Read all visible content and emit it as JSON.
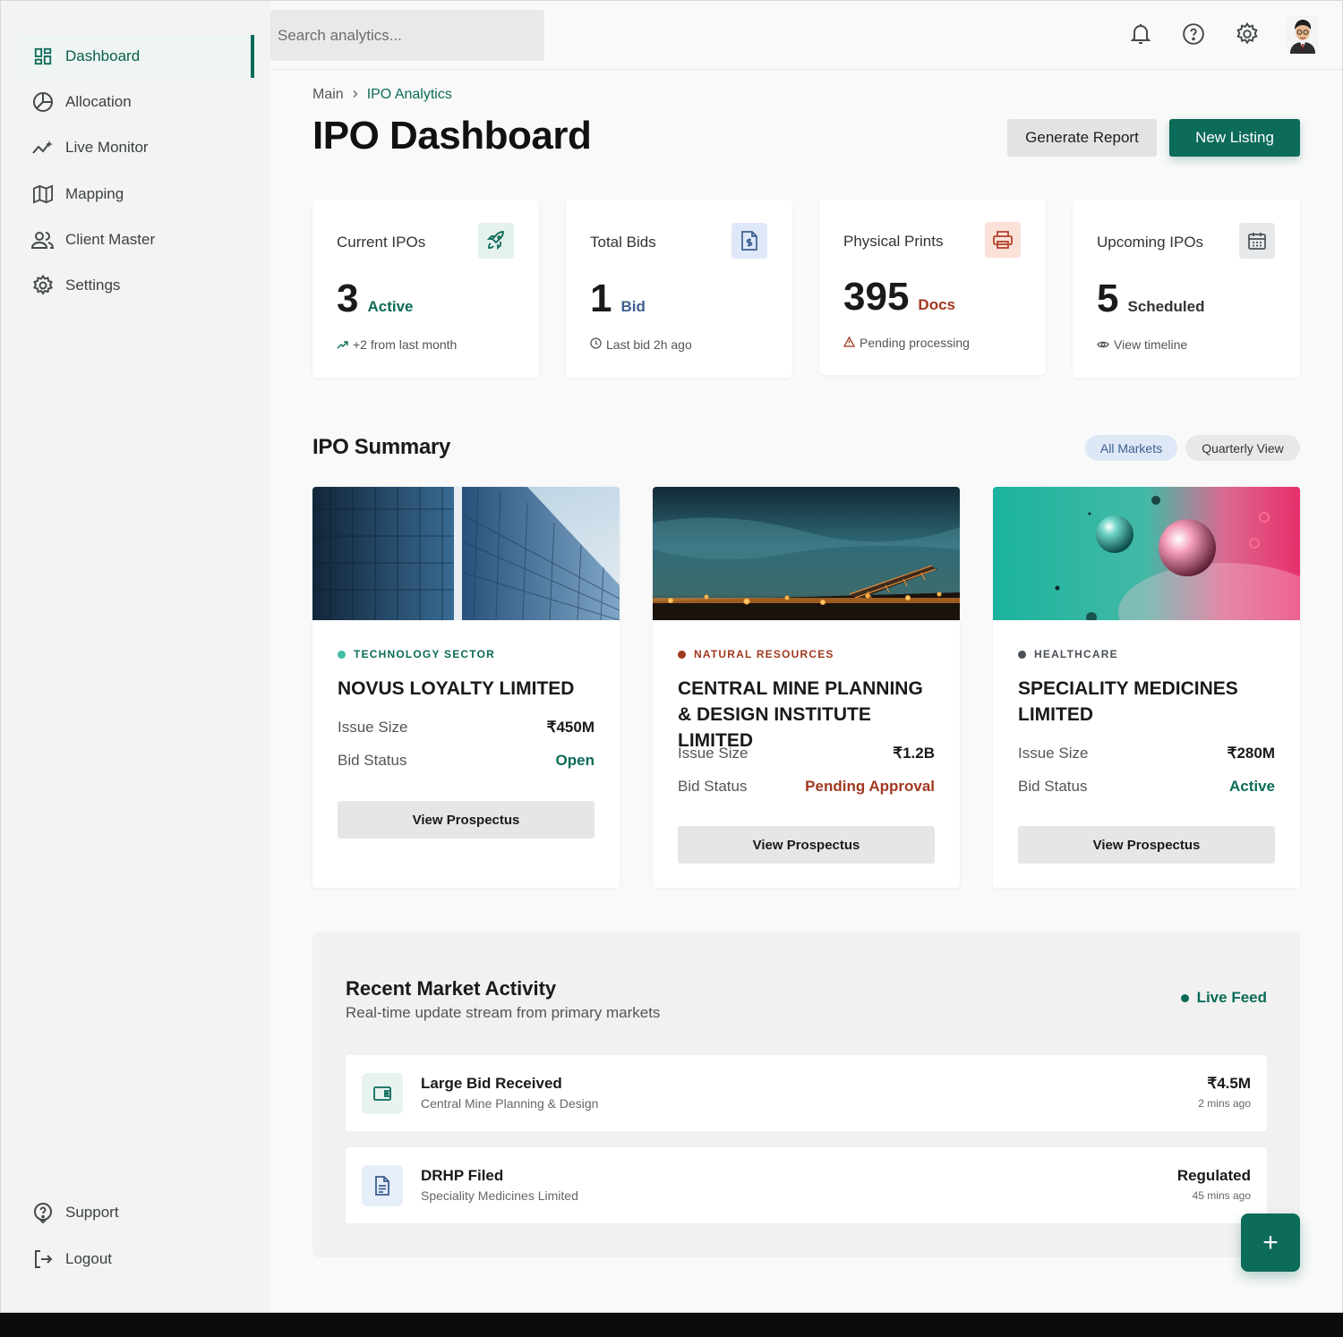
{
  "search": {
    "placeholder": "Search analytics..."
  },
  "sidebar": {
    "items": [
      {
        "label": "Dashboard",
        "icon": "dashboard-icon"
      },
      {
        "label": "Allocation",
        "icon": "pie-chart-icon"
      },
      {
        "label": "Live Monitor",
        "icon": "activity-icon"
      },
      {
        "label": "Mapping",
        "icon": "map-icon"
      },
      {
        "label": "Client Master",
        "icon": "users-icon"
      },
      {
        "label": "Settings",
        "icon": "gear-icon"
      }
    ],
    "footer": [
      {
        "label": "Support",
        "icon": "help-icon"
      },
      {
        "label": "Logout",
        "icon": "logout-icon"
      }
    ]
  },
  "breadcrumb": {
    "root": "Main",
    "current": "IPO Analytics"
  },
  "page": {
    "title": "IPO Dashboard",
    "generate_label": "Generate Report",
    "new_label": "New Listing"
  },
  "stats": [
    {
      "label": "Current IPOs",
      "value": "3",
      "unit": "Active",
      "footer": "+2 from last month",
      "icon": "rocket-icon"
    },
    {
      "label": "Total Bids",
      "value": "1",
      "unit": "Bid",
      "footer": "Last bid 2h ago",
      "icon": "document-dollar-icon"
    },
    {
      "label": "Physical Prints",
      "value": "395",
      "unit": "Docs",
      "footer": "Pending processing",
      "icon": "printer-icon"
    },
    {
      "label": "Upcoming IPOs",
      "value": "5",
      "unit": "Scheduled",
      "footer": "View timeline",
      "icon": "calendar-icon"
    }
  ],
  "summary": {
    "title": "IPO Summary",
    "filters": [
      "All Markets",
      "Quarterly View"
    ],
    "cards": [
      {
        "sector": "TECHNOLOGY SECTOR",
        "name": "NOVUS LOYALTY LIMITED",
        "issue_label": "Issue Size",
        "issue_value": "₹450M",
        "status_label": "Bid Status",
        "status_value": "Open",
        "button": "View Prospectus"
      },
      {
        "sector": "NATURAL RESOURCES",
        "name": "CENTRAL MINE PLANNING & DESIGN INSTITUTE LIMITED",
        "issue_label": "Issue Size",
        "issue_value": "₹1.2B",
        "status_label": "Bid Status",
        "status_value": "Pending Approval",
        "button": "View Prospectus"
      },
      {
        "sector": "HEALTHCARE",
        "name": "SPECIALITY MEDICINES LIMITED",
        "issue_label": "Issue Size",
        "issue_value": "₹280M",
        "status_label": "Bid Status",
        "status_value": "Active",
        "button": "View Prospectus"
      }
    ]
  },
  "activity": {
    "title": "Recent Market Activity",
    "subtitle": "Real-time update stream from primary markets",
    "live_label": "Live Feed",
    "rows": [
      {
        "title": "Large Bid Received",
        "company": "Central Mine Planning & Design",
        "value": "₹4.5M",
        "time": "2 mins ago",
        "icon": "wallet-icon"
      },
      {
        "title": "DRHP Filed",
        "company": "Speciality Medicines Limited",
        "value": "Regulated",
        "time": "45 mins ago",
        "icon": "file-icon"
      }
    ]
  },
  "fab": {
    "label": "+"
  },
  "colors": {
    "accent": "#0c6b59",
    "tech": "#3fbfa3",
    "resources": "#a0391f",
    "health": "#4a5058",
    "pending": "#a0391f"
  }
}
